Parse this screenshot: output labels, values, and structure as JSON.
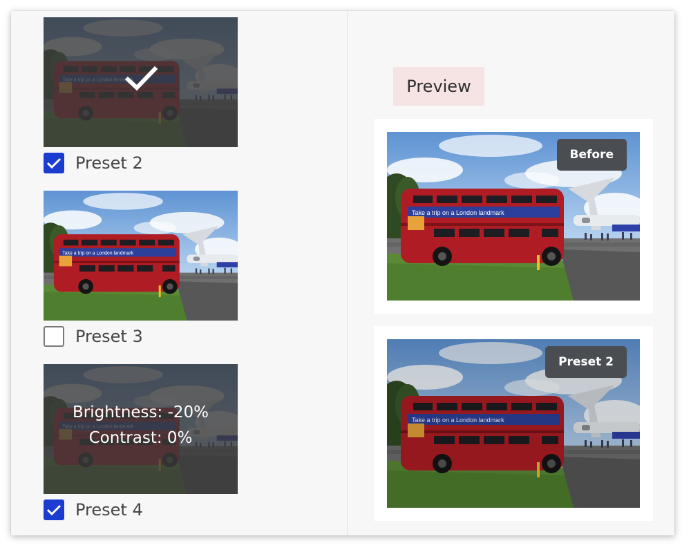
{
  "panel": {
    "presets": [
      {
        "id": "preset-2",
        "label": "Preset 2",
        "checked": true,
        "applied": true,
        "hover_info": null
      },
      {
        "id": "preset-3",
        "label": "Preset 3",
        "checked": false,
        "applied": false,
        "hover_info": null
      },
      {
        "id": "preset-4",
        "label": "Preset 4",
        "checked": true,
        "applied": false,
        "hover_info": {
          "brightness": "Brightness: -20%",
          "contrast": "Contrast: 0%"
        }
      }
    ]
  },
  "preview": {
    "title": "Preview",
    "before_badge": "Before",
    "after_badge": "Preset 2"
  },
  "bus_ad_text": "Take a trip on a London landmark",
  "colors": {
    "checkbox_checked": "#1c3bd0",
    "preview_chip_bg": "#f6e3e3",
    "badge_bg": "#4a4e53",
    "bus_red": "#b01c24"
  },
  "icons": [
    "checkmark-icon"
  ]
}
